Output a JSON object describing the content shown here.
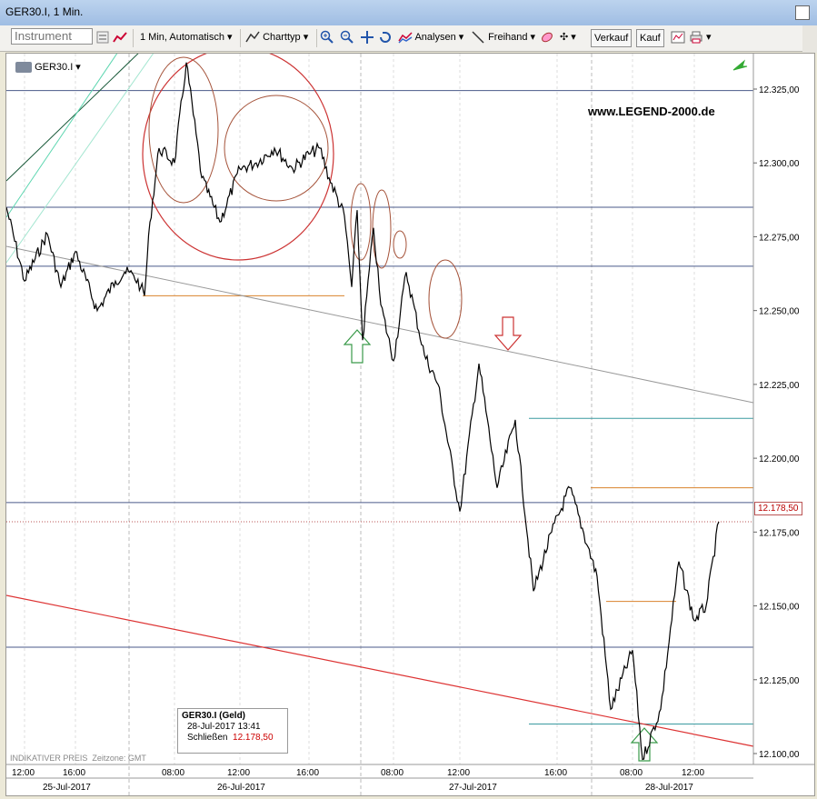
{
  "window": {
    "title": "GER30.I, 1 Min."
  },
  "toolbar": {
    "instrument_placeholder": "Instrument",
    "interval_label": "1 Min, Automatisch",
    "charttype_label": "Charttyp",
    "analysen_label": "Analysen",
    "freihand_label": "Freihand",
    "sell_label": "Verkauf",
    "buy_label": "Kauf"
  },
  "chart": {
    "symbol": "GER30.I",
    "watermark": "www.LEGEND-2000.de",
    "footer_left": "INDIKATIVER PREIS",
    "footer_tz": "Zeitzone: GMT",
    "current_price_label": "12.178,50",
    "info_box": {
      "title": "GER30.I (Geld)",
      "datetime": "28-Jul-2017 13:41",
      "close_label": "Schließen",
      "close_value": "12.178,50"
    },
    "y_ticks": [
      "12.325,00",
      "12.300,00",
      "12.275,00",
      "12.250,00",
      "12.225,00",
      "12.200,00",
      "12.175,00",
      "12.150,00",
      "12.125,00",
      "12.100,00"
    ],
    "x_ticks": [
      "12:00",
      "16:00",
      "08:00",
      "12:00",
      "16:00",
      "08:00",
      "12:00",
      "16:00",
      "08:00",
      "12:00"
    ],
    "date_labels": [
      "25-Jul-2017",
      "26-Jul-2017",
      "27-Jul-2017",
      "28-Jul-2017"
    ]
  },
  "chart_data": {
    "type": "line",
    "title": "GER30.I, 1 Min.",
    "xlabel": "",
    "ylabel": "",
    "ylim": [
      12090,
      12335
    ],
    "series": [
      {
        "name": "GER30.I",
        "points": [
          [
            "25-Jul 10:00",
            12285
          ],
          [
            "25-Jul 11:00",
            12260
          ],
          [
            "25-Jul 12:00",
            12276
          ],
          [
            "25-Jul 13:00",
            12258
          ],
          [
            "25-Jul 14:00",
            12270
          ],
          [
            "25-Jul 15:00",
            12250
          ],
          [
            "25-Jul 16:00",
            12260
          ],
          [
            "25-Jul 17:00",
            12263
          ],
          [
            "25-Jul 18:00",
            12262
          ],
          [
            "25-Jul 20:00",
            12258
          ],
          [
            "25-Jul 21:00",
            12255
          ],
          [
            "26-Jul 06:00",
            12280
          ],
          [
            "26-Jul 07:00",
            12305
          ],
          [
            "26-Jul 08:00",
            12300
          ],
          [
            "26-Jul 09:00",
            12334
          ],
          [
            "26-Jul 10:00",
            12295
          ],
          [
            "26-Jul 11:00",
            12280
          ],
          [
            "26-Jul 12:00",
            12298
          ],
          [
            "26-Jul 13:00",
            12300
          ],
          [
            "26-Jul 14:00",
            12305
          ],
          [
            "26-Jul 15:00",
            12298
          ],
          [
            "26-Jul 16:00",
            12303
          ],
          [
            "26-Jul 17:00",
            12305
          ],
          [
            "26-Jul 18:00",
            12295
          ],
          [
            "26-Jul 20:00",
            12282
          ],
          [
            "26-Jul 21:00",
            12258
          ],
          [
            "27-Jul 06:00",
            12284
          ],
          [
            "27-Jul 07:00",
            12240
          ],
          [
            "27-Jul 08:00",
            12278
          ],
          [
            "27-Jul 09:00",
            12252
          ],
          [
            "27-Jul 10:00",
            12233
          ],
          [
            "27-Jul 11:00",
            12263
          ],
          [
            "27-Jul 12:00",
            12235
          ],
          [
            "27-Jul 13:00",
            12225
          ],
          [
            "27-Jul 14:00",
            12182
          ],
          [
            "27-Jul 15:00",
            12232
          ],
          [
            "27-Jul 16:00",
            12190
          ],
          [
            "27-Jul 17:00",
            12213
          ],
          [
            "27-Jul 18:00",
            12155
          ],
          [
            "27-Jul 19:00",
            12175
          ],
          [
            "27-Jul 20:00",
            12190
          ],
          [
            "27-Jul 21:00",
            12170
          ],
          [
            "28-Jul 06:00",
            12160
          ],
          [
            "28-Jul 07:00",
            12115
          ],
          [
            "28-Jul 08:00",
            12135
          ],
          [
            "28-Jul 09:00",
            12098
          ],
          [
            "28-Jul 10:00",
            12115
          ],
          [
            "28-Jul 11:00",
            12165
          ],
          [
            "28-Jul 12:00",
            12145
          ],
          [
            "28-Jul 13:00",
            12150
          ],
          [
            "28-Jul 13:41",
            12178.5
          ]
        ]
      }
    ]
  }
}
